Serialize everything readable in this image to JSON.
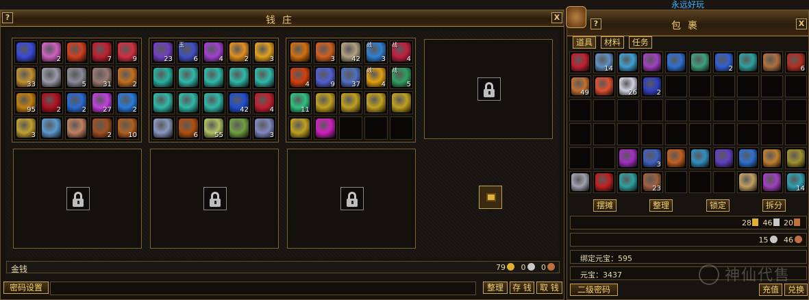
{
  "top_strip": {
    "left_text": "",
    "right_text": "永远好玩"
  },
  "bank": {
    "title": "钱庄",
    "help_label": "?",
    "close_label": "X",
    "grid1": [
      {
        "c": "#3a4ad8",
        "n": ""
      },
      {
        "c": "#d060c0",
        "n": "2"
      },
      {
        "c": "#d04020",
        "n": ""
      },
      {
        "c": "#c02030",
        "n": "7"
      },
      {
        "c": "#d03040",
        "n": "9"
      },
      {
        "c": "#c09030",
        "n": "33"
      },
      {
        "c": "#9a9aa8",
        "n": ""
      },
      {
        "c": "#8a8a98",
        "n": "5"
      },
      {
        "c": "#9a7a70",
        "n": "31"
      },
      {
        "c": "#c07020",
        "n": "2"
      },
      {
        "c": "#c08010",
        "n": "95"
      },
      {
        "c": "#b01020",
        "n": "2"
      },
      {
        "c": "#2a6ad0",
        "n": "2"
      },
      {
        "c": "#c040e0",
        "n": "27"
      },
      {
        "c": "#2a7ad8",
        "n": "2"
      },
      {
        "c": "#c0a030",
        "n": "3"
      },
      {
        "c": "#5a9ad0",
        "n": ""
      },
      {
        "c": "#c08060",
        "n": ""
      },
      {
        "c": "#a05020",
        "n": "2"
      },
      {
        "c": "#b06020",
        "n": "10"
      }
    ],
    "grid2": [
      {
        "c": "#7040c0",
        "n": "23"
      },
      {
        "c": "#4050c0",
        "n": "6",
        "t": "玉"
      },
      {
        "c": "#a040d0",
        "n": "4"
      },
      {
        "c": "#e09020",
        "n": "2"
      },
      {
        "c": "#e0a020",
        "n": "3"
      },
      {
        "c": "#28b0a0",
        "n": ""
      },
      {
        "c": "#30b8a8",
        "n": ""
      },
      {
        "c": "#30b8a8",
        "n": ""
      },
      {
        "c": "#30b8a8",
        "n": ""
      },
      {
        "c": "#30b8a8",
        "n": ""
      },
      {
        "c": "#30b8a8",
        "n": ""
      },
      {
        "c": "#30b8a8",
        "n": ""
      },
      {
        "c": "#30b8a8",
        "n": ""
      },
      {
        "c": "#2050d0",
        "n": "42"
      },
      {
        "c": "#c02030",
        "n": "4"
      },
      {
        "c": "#8a98c0",
        "n": ""
      },
      {
        "c": "#b05010",
        "n": "6"
      },
      {
        "c": "#b0c060",
        "n": "55"
      },
      {
        "c": "#70a040",
        "n": ""
      },
      {
        "c": "#8088c0",
        "n": "3"
      }
    ],
    "grid3": [
      {
        "c": "#d07010",
        "n": ""
      },
      {
        "c": "#d06020",
        "n": "3"
      },
      {
        "c": "#b0a080",
        "n": "42"
      },
      {
        "c": "#3080d0",
        "n": "3",
        "t": "战"
      },
      {
        "c": "#c02040",
        "n": "4",
        "t": "战"
      },
      {
        "c": "#d04010",
        "n": "4"
      },
      {
        "c": "#5060d0",
        "n": "9"
      },
      {
        "c": "#5070c0",
        "n": "37"
      },
      {
        "c": "#e0a010",
        "n": "4",
        "t": "战"
      },
      {
        "c": "#30a060",
        "n": "5",
        "t": "战"
      },
      {
        "c": "#30c080",
        "n": "11"
      },
      {
        "c": "#c0a020",
        "n": ""
      },
      {
        "c": "#c0a020",
        "n": ""
      },
      {
        "c": "#c0a020",
        "n": ""
      },
      {
        "c": "#c0a020",
        "n": ""
      },
      {
        "c": "#c0a020",
        "n": ""
      },
      {
        "c": "#d020c0",
        "n": ""
      },
      {
        "c": "",
        "n": ""
      },
      {
        "c": "",
        "n": ""
      },
      {
        "c": "",
        "n": ""
      }
    ],
    "gold_label": "金钱",
    "gold_values": [
      "79",
      "0",
      "0"
    ],
    "buttons": {
      "password": "密码设置",
      "sort": "整理",
      "deposit": "存 钱",
      "withdraw": "取 钱"
    },
    "colors": {
      "gold": "#e0b030",
      "silver": "#c8c8c8",
      "copper": "#c07040"
    }
  },
  "bag": {
    "title": "包裹",
    "help_label": "?",
    "close_label": "X",
    "tabs": [
      "道具",
      "材料",
      "任务"
    ],
    "items": [
      {
        "c": "#c02030",
        "n": ""
      },
      {
        "c": "#6090c0",
        "n": "14"
      },
      {
        "c": "#40a0d0",
        "n": ""
      },
      {
        "c": "#a040c0",
        "n": ""
      },
      {
        "c": "#3070d0",
        "n": ""
      },
      {
        "c": "#40a080",
        "n": ""
      },
      {
        "c": "#3060d0",
        "n": "2"
      },
      {
        "c": "#30a0a0",
        "n": ""
      },
      {
        "c": "#b07040",
        "n": ""
      },
      {
        "c": "#b03020",
        "n": "6"
      },
      {
        "c": "#c07030",
        "n": "49"
      },
      {
        "c": "#e05030",
        "n": ""
      },
      {
        "c": "#d0d0e0",
        "n": "26"
      },
      {
        "c": "#3040c0",
        "n": "2"
      },
      {
        "c": "",
        "n": ""
      },
      {
        "c": "",
        "n": ""
      },
      {
        "c": "",
        "n": ""
      },
      {
        "c": "",
        "n": ""
      },
      {
        "c": "",
        "n": ""
      },
      {
        "c": "",
        "n": ""
      },
      {
        "c": "",
        "n": ""
      },
      {
        "c": "",
        "n": ""
      },
      {
        "c": "",
        "n": ""
      },
      {
        "c": "",
        "n": ""
      },
      {
        "c": "",
        "n": ""
      },
      {
        "c": "",
        "n": ""
      },
      {
        "c": "",
        "n": ""
      },
      {
        "c": "",
        "n": ""
      },
      {
        "c": "",
        "n": ""
      },
      {
        "c": "",
        "n": ""
      },
      {
        "c": "",
        "n": ""
      },
      {
        "c": "",
        "n": ""
      },
      {
        "c": "",
        "n": ""
      },
      {
        "c": "",
        "n": ""
      },
      {
        "c": "",
        "n": ""
      },
      {
        "c": "",
        "n": ""
      },
      {
        "c": "",
        "n": ""
      },
      {
        "c": "",
        "n": ""
      },
      {
        "c": "",
        "n": ""
      },
      {
        "c": "",
        "n": ""
      },
      {
        "c": "",
        "n": ""
      },
      {
        "c": "",
        "n": ""
      },
      {
        "c": "#a030c0",
        "n": ""
      },
      {
        "c": "#4060c0",
        "n": "3"
      },
      {
        "c": "#c06020",
        "n": ""
      },
      {
        "c": "#3090c0",
        "n": ""
      },
      {
        "c": "#6040c0",
        "n": ""
      },
      {
        "c": "#3070d0",
        "n": ""
      },
      {
        "c": "#c08030",
        "n": ""
      },
      {
        "c": "#a09030",
        "n": ""
      },
      {
        "c": "#a0a0b0",
        "n": ""
      },
      {
        "c": "#c02020",
        "n": ""
      },
      {
        "c": "#30a0a0",
        "n": ""
      },
      {
        "c": "#a06040",
        "n": "23"
      },
      {
        "c": "",
        "n": ""
      },
      {
        "c": "",
        "n": ""
      },
      {
        "c": "",
        "n": ""
      },
      {
        "c": "#c0a060",
        "n": ""
      },
      {
        "c": "#a040c0",
        "n": ""
      },
      {
        "c": "#30a0b0",
        "n": "14"
      }
    ],
    "buttons": {
      "stall": "摆摊",
      "sort": "整理",
      "lock": "锁定",
      "split": "拆分",
      "password2": "二级密码",
      "recharge": "充值",
      "exchange": "兑换"
    },
    "money_row1": [
      "28",
      "46",
      "20"
    ],
    "money_row2": [
      "15",
      "46"
    ],
    "bound_yuanbao": "绑定元宝：595",
    "yuanbao": "元宝：3437"
  },
  "watermark": "神仙代售"
}
